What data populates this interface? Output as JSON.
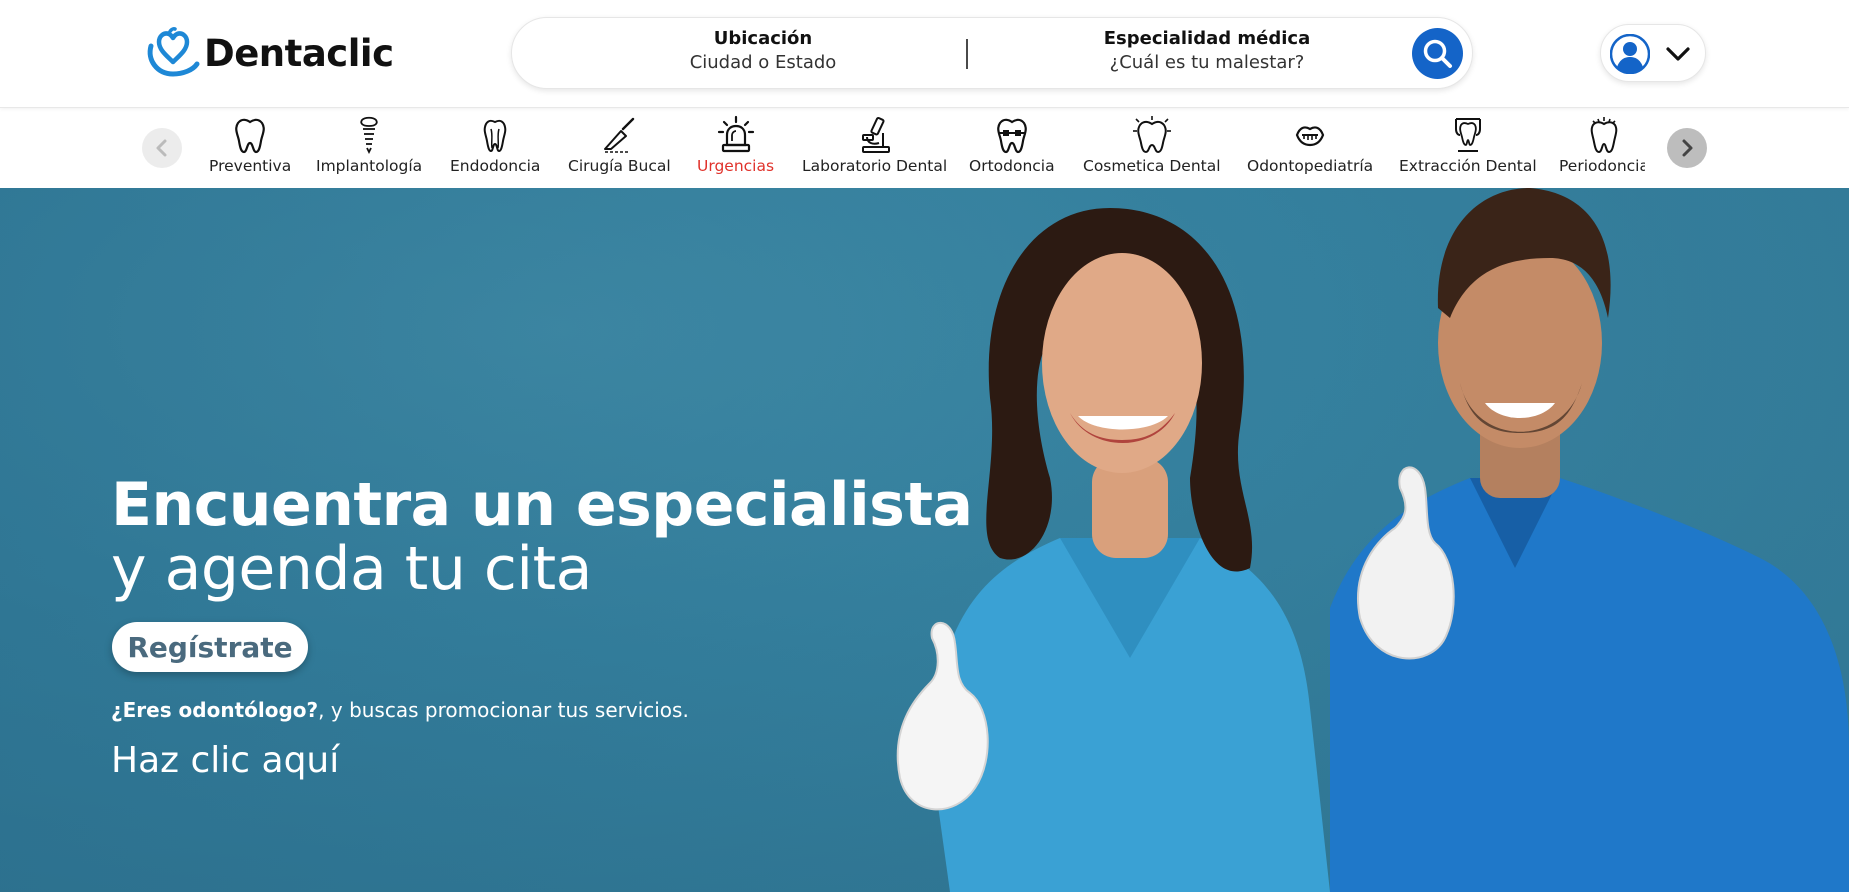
{
  "brand": {
    "name": "Dentaclic",
    "accent": "#1464c8",
    "icon": "tooth-heart-logo-icon"
  },
  "search": {
    "location_label": "Ubicación",
    "location_placeholder": "Ciudad o Estado",
    "specialty_label": "Especialidad médica",
    "specialty_placeholder": "¿Cuál es tu malestar?",
    "button_icon": "search-icon"
  },
  "user_menu": {
    "avatar_icon": "user-avatar-icon",
    "toggle_icon": "chevron-down-icon"
  },
  "categories": {
    "prev_icon": "chevron-left-icon",
    "next_icon": "chevron-right-icon",
    "active_color": "#e0322b",
    "items": [
      {
        "label": "Preventiva",
        "icon": "tooth-icon"
      },
      {
        "label": "Implantología",
        "icon": "dental-implant-icon"
      },
      {
        "label": "Endodoncia",
        "icon": "tooth-root-icon"
      },
      {
        "label": "Cirugía Bucal",
        "icon": "scalpel-icon"
      },
      {
        "label": "Urgencias",
        "icon": "emergency-siren-icon",
        "active": true
      },
      {
        "label": "Laboratorio Dental",
        "icon": "microscope-icon"
      },
      {
        "label": "Ortodoncia",
        "icon": "braces-tooth-icon"
      },
      {
        "label": "Cosmetica Dental",
        "icon": "sparkle-tooth-icon"
      },
      {
        "label": "Odontopediatría",
        "icon": "child-smile-icon"
      },
      {
        "label": "Extracción Dental",
        "icon": "tooth-extraction-icon"
      },
      {
        "label": "Periodoncia",
        "icon": "gum-tooth-icon"
      }
    ]
  },
  "hero": {
    "title_line1": "Encuentra un especialista",
    "title_line2": "y agenda tu cita",
    "register_button": "Regístrate",
    "promo_bold": "¿Eres odontólogo?",
    "promo_rest": ", y buscas promocionar tus servicios.",
    "cta_link": "Haz clic aquí",
    "background_color": "#347f9d",
    "image_icon": "smiling-dentists-image"
  }
}
